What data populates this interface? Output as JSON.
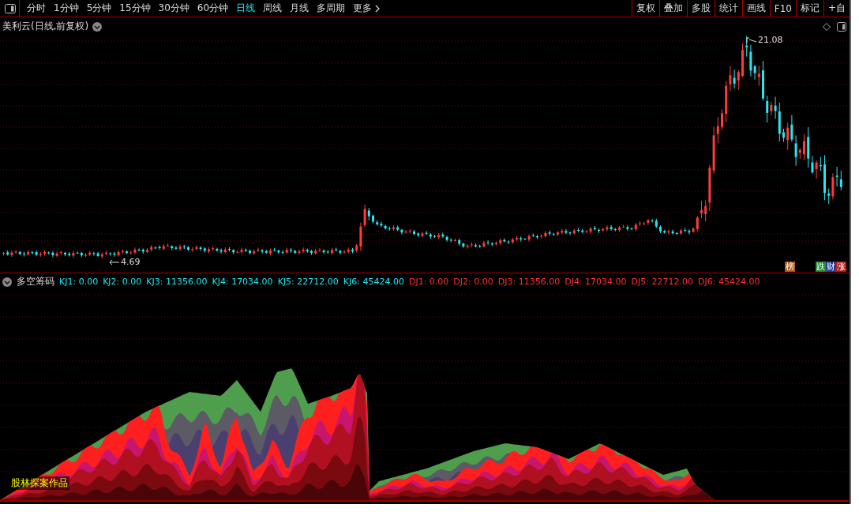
{
  "toolbar": {
    "periods": [
      {
        "label": "分时",
        "selected": false
      },
      {
        "label": "1分钟",
        "selected": false
      },
      {
        "label": "5分钟",
        "selected": false
      },
      {
        "label": "15分钟",
        "selected": false
      },
      {
        "label": "30分钟",
        "selected": false
      },
      {
        "label": "60分钟",
        "selected": false
      },
      {
        "label": "日线",
        "selected": true
      },
      {
        "label": "周线",
        "selected": false
      },
      {
        "label": "月线",
        "selected": false
      },
      {
        "label": "多周期",
        "selected": false
      },
      {
        "label": "更多",
        "selected": false
      }
    ],
    "tools": [
      "复权",
      "叠加",
      "多股",
      "统计",
      "画线",
      "F10",
      "标记",
      "+自"
    ]
  },
  "price_pane": {
    "title": "美利云(日线,前复权)",
    "high_label": "21.08",
    "low_label": "4.69",
    "badges": [
      {
        "label": "榜",
        "color": "#b05a1e"
      },
      {
        "label": "跌",
        "color": "#1f8a2e"
      },
      {
        "label": "财",
        "color": "#2a3f9a"
      },
      {
        "label": "涨",
        "color": "#b01e1e"
      }
    ]
  },
  "indicator_pane": {
    "name": "多空筹码",
    "values": [
      {
        "label": "KJ1: 0.00",
        "kind": "kj"
      },
      {
        "label": "KJ2: 0.00",
        "kind": "kj"
      },
      {
        "label": "KJ3: 11356.00",
        "kind": "kj"
      },
      {
        "label": "KJ4: 17034.00",
        "kind": "kj"
      },
      {
        "label": "KJ5: 22712.00",
        "kind": "kj"
      },
      {
        "label": "KJ6: 45424.00",
        "kind": "kj"
      },
      {
        "label": "DJ1: 0.00",
        "kind": "dj"
      },
      {
        "label": "DJ2: 0.00",
        "kind": "dj"
      },
      {
        "label": "DJ3: 11356.00",
        "kind": "dj"
      },
      {
        "label": "DJ4: 17034.00",
        "kind": "dj"
      },
      {
        "label": "DJ5: 22712.00",
        "kind": "dj"
      },
      {
        "label": "DJ6: 45424.00",
        "kind": "dj"
      }
    ],
    "credit": "股林探案作品"
  }
}
